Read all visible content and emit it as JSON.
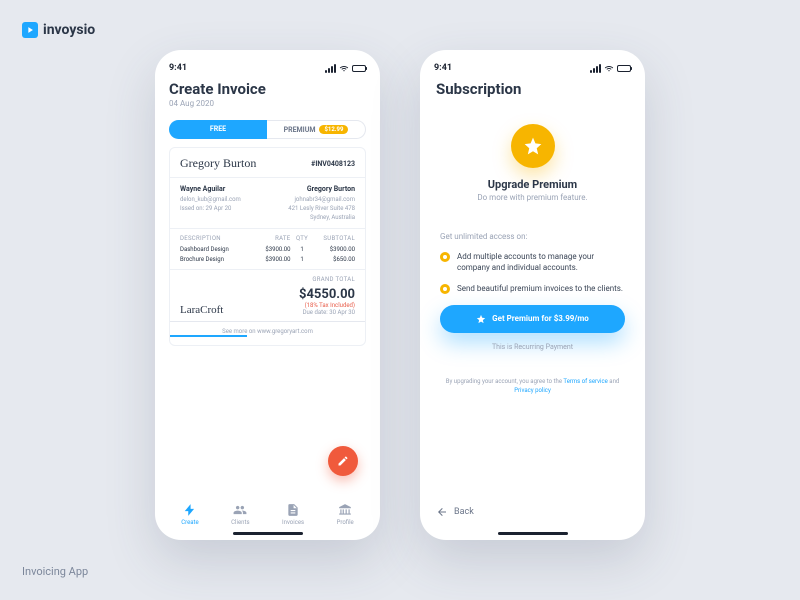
{
  "brand": {
    "name": "invoysio"
  },
  "caption": "Invoicing App",
  "status": {
    "time": "9:41"
  },
  "screen1": {
    "title": "Create Invoice",
    "date": "04 Aug 2020",
    "tabs": {
      "free": "FREE",
      "premium": "PREMIUM",
      "premium_price": "$12.99"
    },
    "invoice": {
      "payer_signature": "Gregory Burton",
      "number": "#INV0408123",
      "from": {
        "name": "Wayne Aguilar",
        "email": "delon_kub@gmail.com",
        "issued": "Issed on: 29 Apr 20"
      },
      "to": {
        "name": "Gregory Burton",
        "email": "johnabr34@gmail.com",
        "addr1": "421 Lesly River Suite 478",
        "addr2": "Sydney, Australia"
      },
      "columns": {
        "desc": "DESCRIPTION",
        "rate": "RATE",
        "qty": "QTY",
        "subtotal": "SUBTOTAL"
      },
      "items": [
        {
          "desc": "Dashboard Design",
          "rate": "$3900.00",
          "qty": "1",
          "subtotal": "$3900.00"
        },
        {
          "desc": "Brochure Design",
          "rate": "$3900.00",
          "qty": "1",
          "subtotal": "$650.00"
        }
      ],
      "grand_total_label": "GRAND TOTAL",
      "grand_total": "$4550.00",
      "tax_note": "(18% Tax Included)",
      "due": "Due date: 30 Apr 30",
      "signature": "LaraCroft",
      "footer": "See more on www.gregoryart.com"
    },
    "nav": {
      "create": "Create",
      "clients": "Clients",
      "invoices": "Invoices",
      "profile": "Profile"
    }
  },
  "screen2": {
    "title": "Subscription",
    "hero_title": "Upgrade Premium",
    "hero_sub": "Do more with premium feature.",
    "features_label": "Get unlimited access on:",
    "features": [
      "Add multiple accounts to manage your company and individual accounts.",
      "Send beautiful premium invoices to the clients."
    ],
    "cta": "Get Premium for $3.99/mo",
    "recurring": "This is Recurring Payment",
    "legal_pre": "By upgrading your account, you agree to the ",
    "legal_tos": "Terms of service",
    "legal_and": " and ",
    "legal_privacy": "Privacy policy",
    "back": "Back"
  }
}
